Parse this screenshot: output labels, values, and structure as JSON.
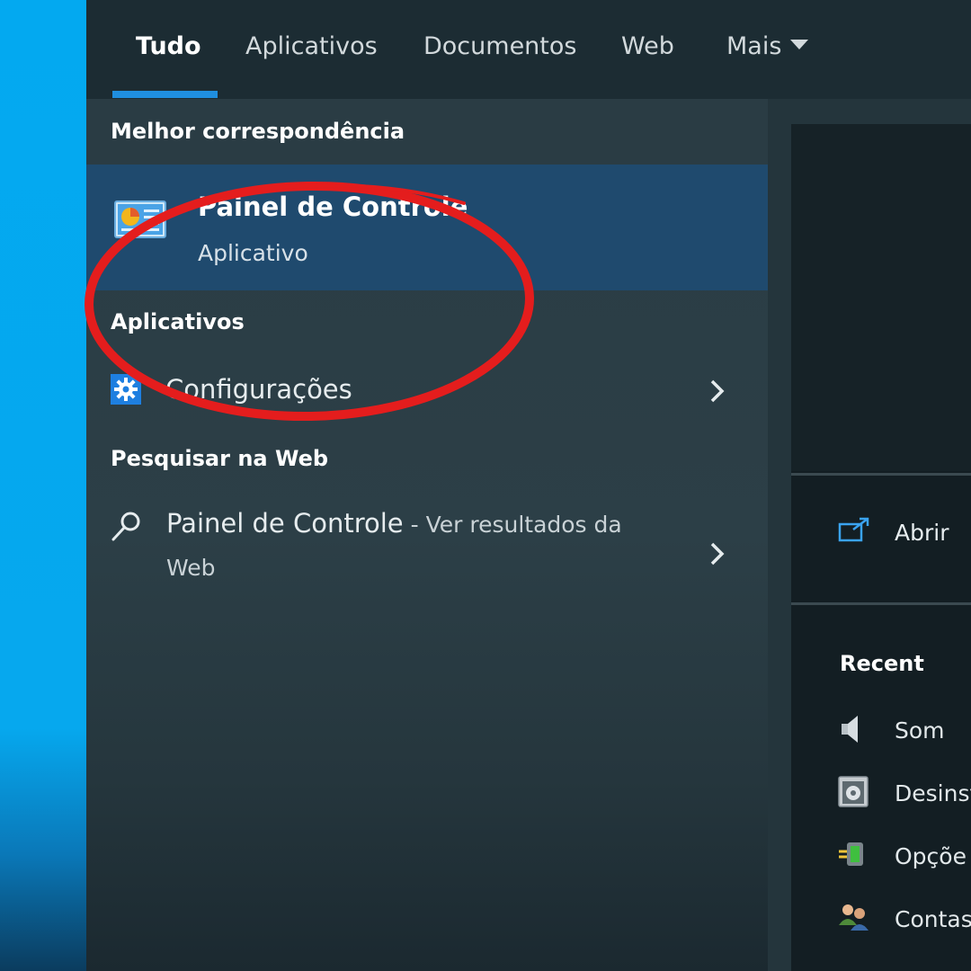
{
  "tabs": [
    {
      "label": "Tudo",
      "active": true
    },
    {
      "label": "Aplicativos",
      "active": false
    },
    {
      "label": "Documentos",
      "active": false
    },
    {
      "label": "Web",
      "active": false
    },
    {
      "label": "Mais",
      "active": false
    }
  ],
  "best_match": {
    "header": "Melhor correspondência",
    "title": "Painel de Controle",
    "subtitle": "Aplicativo",
    "icon": "control-panel-icon"
  },
  "apps": {
    "header": "Aplicativos",
    "items": [
      {
        "label": "Configurações",
        "icon": "gear-icon"
      }
    ]
  },
  "web": {
    "header": "Pesquisar na Web",
    "query": "Painel de Controle",
    "suffix": " - Ver resultados da",
    "suffix_line2": "Web",
    "icon": "search-icon"
  },
  "preview": {
    "actions": [
      {
        "label": "Abrir",
        "icon": "open-icon"
      }
    ],
    "recent_header": "Recent",
    "recent": [
      {
        "label": "Som",
        "icon": "speaker-icon"
      },
      {
        "label": "Desinst",
        "icon": "uninstall-icon"
      },
      {
        "label": "Opçõe",
        "icon": "power-options-icon"
      },
      {
        "label": "Contas",
        "icon": "user-accounts-icon"
      }
    ]
  },
  "colors": {
    "accent": "#1f8fe0",
    "selection": "#1f4a6e",
    "annotation": "#e41d1d",
    "desktop": "#03a9f0"
  }
}
